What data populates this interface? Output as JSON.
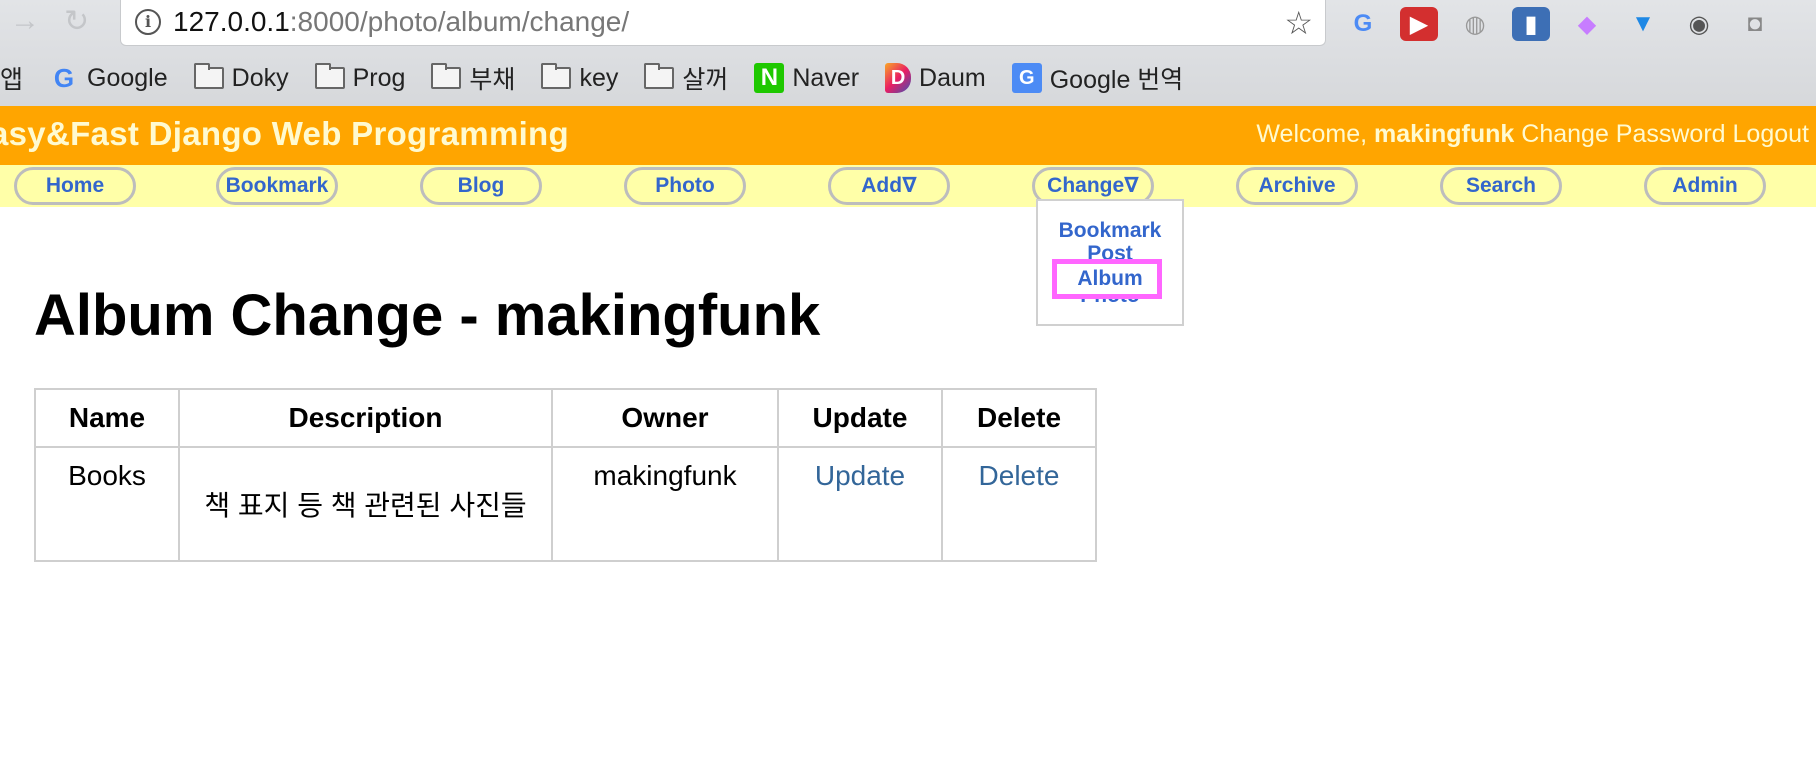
{
  "browser": {
    "url_host": "127.0.0.1",
    "url_rest": ":8000/photo/album/change/",
    "bookmarks": [
      {
        "label": "앱",
        "icon": "apps-icon"
      },
      {
        "label": "Google",
        "icon": "google-icon"
      },
      {
        "label": "Doky",
        "icon": "folder-icon"
      },
      {
        "label": "Prog",
        "icon": "folder-icon"
      },
      {
        "label": "부채",
        "icon": "folder-icon"
      },
      {
        "label": "key",
        "icon": "folder-icon"
      },
      {
        "label": "살꺼",
        "icon": "folder-icon"
      },
      {
        "label": "Naver",
        "icon": "naver-icon"
      },
      {
        "label": "Daum",
        "icon": "daum-icon"
      },
      {
        "label": "Google 번역",
        "icon": "google-translate-icon"
      }
    ],
    "extensions": [
      "translate-extension-icon",
      "media-extension-icon",
      "globe-extension-icon",
      "bookmark-extension-icon",
      "paint-extension-icon",
      "diamond-extension-icon",
      "key-extension-icon",
      "camera-extension-icon"
    ]
  },
  "header": {
    "title": "asy&Fast Django Web Programming",
    "welcome_text": "Welcome,",
    "username": "makingfunk",
    "change_password": "Change Password",
    "logout": "Logout"
  },
  "menu": {
    "home": "Home",
    "bookmark": "Bookmark",
    "blog": "Blog",
    "photo": "Photo",
    "add": "Add∇",
    "change": "Change∇",
    "archive": "Archive",
    "search": "Search",
    "admin": "Admin"
  },
  "dropdown": {
    "bookmark": "Bookmark",
    "post": "Post",
    "album": "Album",
    "photo": "Photo"
  },
  "page": {
    "title": "Album Change - makingfunk"
  },
  "table": {
    "headers": {
      "name": "Name",
      "description": "Description",
      "owner": "Owner",
      "update": "Update",
      "delete": "Delete"
    },
    "rows": [
      {
        "name": "Books",
        "description": "책 표지 등 책 관련된 사진들",
        "owner": "makingfunk",
        "update": "Update",
        "delete": "Delete"
      }
    ]
  },
  "colors": {
    "header_bg": "#ffa500",
    "menubar_bg": "#ffffa8",
    "link": "#3366cc",
    "highlight": "#ff66ff"
  }
}
